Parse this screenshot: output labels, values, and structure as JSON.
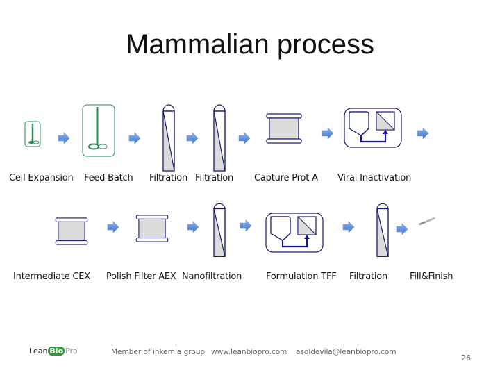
{
  "title": "Mammalian process",
  "row1": {
    "labels": [
      "Cell Expansion",
      "Feed Batch",
      "Filtration",
      "Filtration",
      "Capture Prot A",
      "Viral Inactivation"
    ]
  },
  "row2": {
    "labels": [
      "Intermediate CEX",
      "Polish Filter AEX",
      "Nanofiltration",
      "Formulation TFF",
      "Filtration",
      "Fill&Finish"
    ]
  },
  "icons": {
    "bioreactor_small": "bioreactor-icon",
    "bioreactor_large": "bioreactor-icon",
    "filter": "filter-cartridge-icon",
    "chromatography": "chromatography-column-icon",
    "tank_filter": "tank-filter-icon",
    "arrow": "arrow-right-icon",
    "syringe": "syringe-icon"
  },
  "colors": {
    "vessel_green": "#2e8b57",
    "outline_navy": "#1a1a6e",
    "fill_grey": "#dcdcdc",
    "arrow_blue": "#5b8fd9",
    "logo_green": "#2e9a3c"
  },
  "footer": {
    "logo_lean": "Lean",
    "logo_bio": "Bio",
    "logo_pro": "Pro",
    "member": "Member of inkemia group",
    "website": "www.leanbiopro.com",
    "email": "asoldevila@leanbiopro.com",
    "page_number": "26"
  }
}
